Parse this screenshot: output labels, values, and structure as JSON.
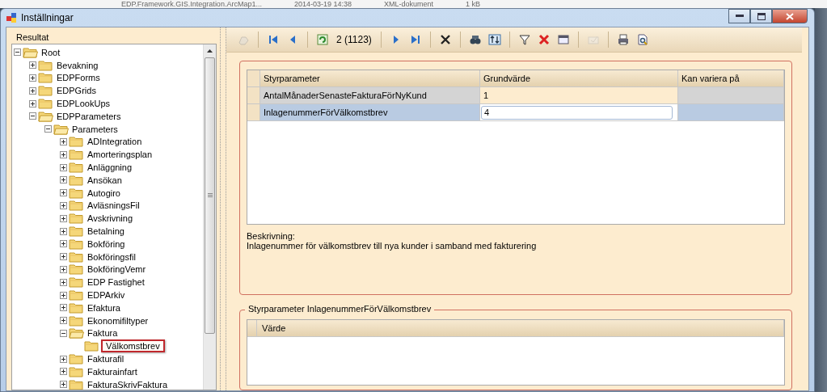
{
  "background_row": {
    "name": "EDP.Framework.GIS.Integration.ArcMap1...",
    "date": "2014-03-19 14:38",
    "type": "XML-dokument",
    "size": "1 kB"
  },
  "window": {
    "title": "Inställningar"
  },
  "tree": {
    "title": "Resultat",
    "items": [
      {
        "label": "Root",
        "expanded": true,
        "selected": false,
        "children": [
          {
            "label": "Bevakning",
            "expanded": false,
            "selected": false
          },
          {
            "label": "EDPForms",
            "expanded": false,
            "selected": false
          },
          {
            "label": "EDPGrids",
            "expanded": false,
            "selected": false
          },
          {
            "label": "EDPLookUps",
            "expanded": false,
            "selected": false
          },
          {
            "label": "EDPParameters",
            "expanded": true,
            "selected": false,
            "children": [
              {
                "label": "Parameters",
                "expanded": true,
                "selected": false,
                "children": [
                  {
                    "label": "ADIntegration",
                    "expanded": false,
                    "selected": false
                  },
                  {
                    "label": "Amorteringsplan",
                    "expanded": false,
                    "selected": false
                  },
                  {
                    "label": "Anläggning",
                    "expanded": false,
                    "selected": false
                  },
                  {
                    "label": "Ansökan",
                    "expanded": false,
                    "selected": false
                  },
                  {
                    "label": "Autogiro",
                    "expanded": false,
                    "selected": false
                  },
                  {
                    "label": "AvläsningsFil",
                    "expanded": false,
                    "selected": false
                  },
                  {
                    "label": "Avskrivning",
                    "expanded": false,
                    "selected": false
                  },
                  {
                    "label": "Betalning",
                    "expanded": false,
                    "selected": false
                  },
                  {
                    "label": "Bokföring",
                    "expanded": false,
                    "selected": false
                  },
                  {
                    "label": "Bokföringsfil",
                    "expanded": false,
                    "selected": false
                  },
                  {
                    "label": "BokföringVemr",
                    "expanded": false,
                    "selected": false
                  },
                  {
                    "label": "EDP Fastighet",
                    "expanded": false,
                    "selected": false
                  },
                  {
                    "label": "EDPArkiv",
                    "expanded": false,
                    "selected": false
                  },
                  {
                    "label": "Efaktura",
                    "expanded": false,
                    "selected": false
                  },
                  {
                    "label": "Ekonomifiltyper",
                    "expanded": false,
                    "selected": false
                  },
                  {
                    "label": "Faktura",
                    "expanded": true,
                    "selected": false,
                    "children": [
                      {
                        "label": "Välkomstbrev",
                        "selected": true
                      }
                    ]
                  },
                  {
                    "label": "Fakturafil",
                    "expanded": false,
                    "selected": false
                  },
                  {
                    "label": "Fakturainfart",
                    "expanded": false,
                    "selected": false
                  },
                  {
                    "label": "FakturaSkrivFaktura",
                    "expanded": false,
                    "selected": false
                  }
                ]
              }
            ]
          }
        ]
      }
    ]
  },
  "toolbar": {
    "items": [
      {
        "kind": "hand",
        "disabled": true
      },
      {
        "kind": "sep"
      },
      {
        "kind": "first",
        "disabled": false
      },
      {
        "kind": "prev",
        "disabled": false
      },
      {
        "kind": "sep"
      },
      {
        "kind": "refresh",
        "disabled": false
      },
      {
        "kind": "position",
        "text": "2 (1123)"
      },
      {
        "kind": "sep"
      },
      {
        "kind": "next",
        "disabled": false
      },
      {
        "kind": "last",
        "disabled": false
      },
      {
        "kind": "sep"
      },
      {
        "kind": "delete",
        "disabled": false
      },
      {
        "kind": "sep"
      },
      {
        "kind": "find",
        "disabled": false
      },
      {
        "kind": "sort",
        "disabled": false
      },
      {
        "kind": "sep"
      },
      {
        "kind": "filter",
        "disabled": false
      },
      {
        "kind": "clear-filter",
        "disabled": false
      },
      {
        "kind": "window",
        "disabled": false
      },
      {
        "kind": "sep"
      },
      {
        "kind": "post",
        "disabled": true
      },
      {
        "kind": "sep"
      },
      {
        "kind": "print",
        "disabled": false
      },
      {
        "kind": "preview",
        "disabled": false
      }
    ]
  },
  "parameter_grid": {
    "columns": [
      "Styrparameter",
      "Grundvärde",
      "Kan variera på"
    ],
    "rows": [
      {
        "name": "AntalMånaderSenasteFakturaFörNyKund",
        "value": "1",
        "editing": false,
        "selected": false
      },
      {
        "name": "InlagenummerFörVälkomstbrev",
        "value": "4",
        "editing": true,
        "selected": true
      }
    ]
  },
  "description": {
    "label": "Beskrivning:",
    "text": "Inlagenummer för välkomstbrev till nya kunder i samband med fakturering"
  },
  "detail": {
    "title": "Styrparameter InlagenummerFörVälkomstbrev",
    "columns": [
      "Värde"
    ]
  }
}
